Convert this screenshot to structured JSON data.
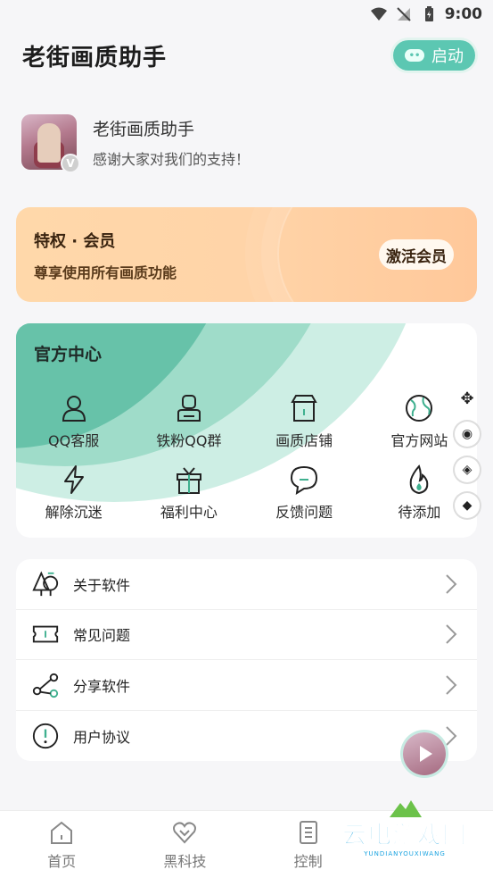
{
  "status_bar": {
    "time": "9:00"
  },
  "header": {
    "title": "老街画质助手",
    "launch_label": "启动"
  },
  "profile": {
    "name": "老街画质助手",
    "subtitle": "感谢大家对我们的支持！",
    "badge": "V"
  },
  "vip": {
    "title": "特权 · 会员",
    "subtitle": "尊享使用所有画质功能",
    "button": "激活会员"
  },
  "official": {
    "title": "官方中心",
    "items": [
      {
        "label": "QQ客服",
        "icon": "user-icon"
      },
      {
        "label": "铁粉QQ群",
        "icon": "group-user-icon"
      },
      {
        "label": "画质店铺",
        "icon": "store-icon"
      },
      {
        "label": "官方网站",
        "icon": "globe-icon"
      },
      {
        "label": "解除沉迷",
        "icon": "lightning-icon"
      },
      {
        "label": "福利中心",
        "icon": "gift-icon"
      },
      {
        "label": "反馈问题",
        "icon": "chat-bubble-icon"
      },
      {
        "label": "待添加",
        "icon": "flame-icon"
      }
    ]
  },
  "side_tools": [
    "move-icon",
    "target-icon",
    "target-icon",
    "target-icon"
  ],
  "menu": {
    "items": [
      {
        "label": "关于软件",
        "icon": "tree-icon"
      },
      {
        "label": "常见问题",
        "icon": "ticket-icon"
      },
      {
        "label": "分享软件",
        "icon": "share-icon"
      },
      {
        "label": "用户协议",
        "icon": "alert-circle-icon"
      }
    ]
  },
  "bottom_nav": {
    "items": [
      {
        "label": "首页",
        "icon": "home-icon"
      },
      {
        "label": "黑科技",
        "icon": "heart-icon"
      },
      {
        "label": "控制",
        "icon": "document-icon"
      }
    ]
  },
  "watermark": {
    "text": "云电游戏网",
    "sub": "YUNDIANYOUXIWANG"
  },
  "colors": {
    "accent": "#5cc7b2",
    "vip_gradient_start": "#ffd8aa",
    "vip_gradient_end": "#ffc89a",
    "background": "#f6f6f8"
  }
}
